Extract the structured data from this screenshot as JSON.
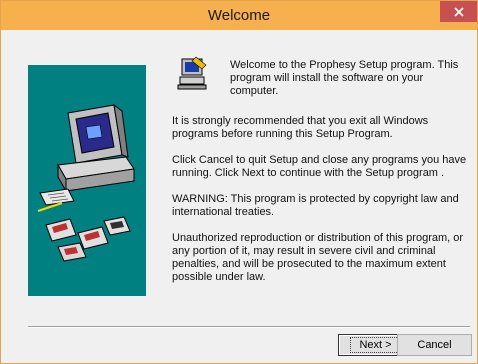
{
  "window": {
    "title": "Welcome",
    "close_glyph": "×"
  },
  "dialog": {
    "intro": "Welcome to the Prophesy Setup program. This program will install the software on your computer.",
    "para1": "It is strongly recommended that you exit all Windows programs before running this Setup Program.",
    "para2": "Click Cancel to quit Setup and close any programs you have running.  Click Next to continue with the Setup program .",
    "para3": "WARNING: This program is protected by copyright law and international treaties.",
    "para4": "Unauthorized reproduction or distribution of this program, or any portion of it, may result in severe civil and criminal penalties, and will be prosecuted to the maximum extent possible under law."
  },
  "buttons": {
    "next_label": "Next >",
    "cancel_label": "Cancel"
  },
  "colors": {
    "titlebar": "#f6b04d",
    "close": "#c75050",
    "art_panel": "#008080"
  },
  "icons": {
    "close": "close-icon",
    "setup": "setup-computer-icon",
    "art": "computer-with-disks-illustration"
  }
}
